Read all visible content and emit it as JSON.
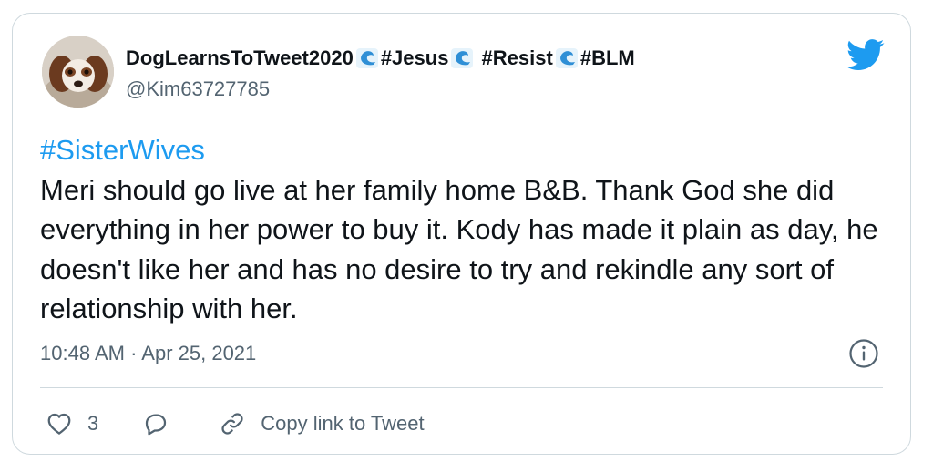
{
  "tweet": {
    "display_name_parts": [
      "DogLearnsToTweet2020",
      "#Jesus",
      " #Resist",
      "#BLM"
    ],
    "handle": "@Kim63727785",
    "hashtag": "#SisterWives",
    "body": "Meri should go live at her family home B&B. Thank God she did everything in her power to buy it. Kody has made it plain as day, he doesn't like her and has no desire to try and rekindle any sort of relationship with her.",
    "timestamp": "10:48 AM · Apr 25, 2021"
  },
  "actions": {
    "like_count": "3",
    "copy_link_label": "Copy link to Tweet"
  },
  "icons": {
    "brand": "twitter-bird-icon",
    "name_emoji": "water-wave-icon",
    "info": "info-icon",
    "like": "heart-icon",
    "reply": "speech-bubble-icon",
    "link": "link-icon"
  },
  "colors": {
    "accent": "#1d9bf0",
    "text": "#0f1419",
    "secondary": "#536471",
    "border": "#cfd9de"
  }
}
